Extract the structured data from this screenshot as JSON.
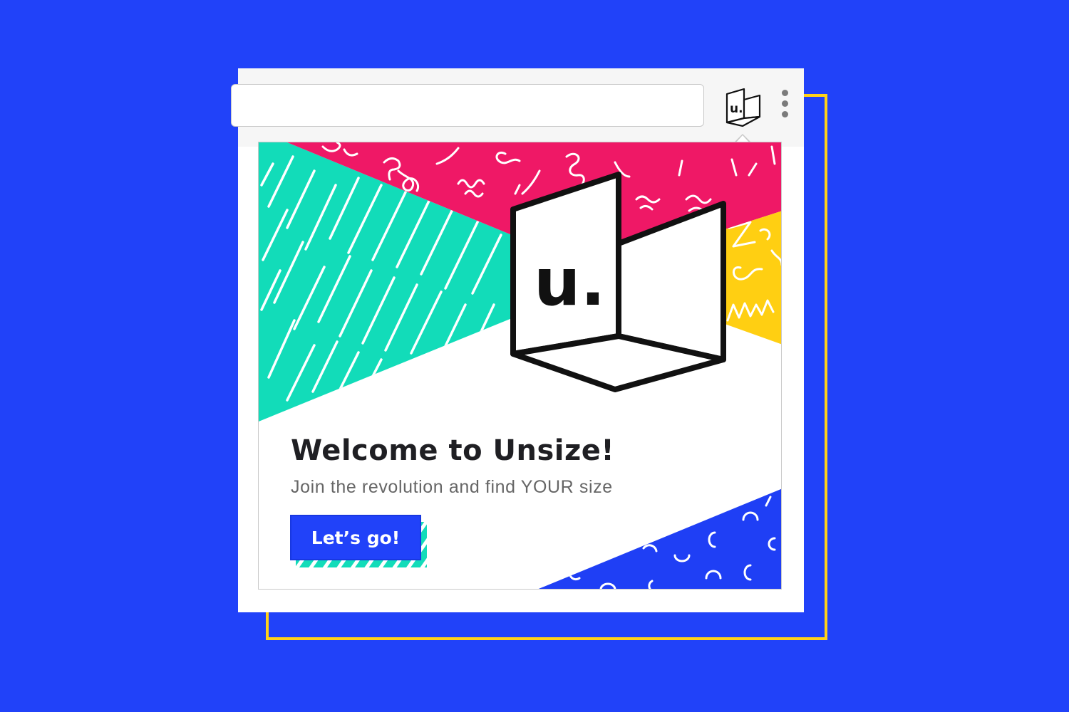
{
  "popup": {
    "title": "Welcome to Unsize!",
    "subtitle": "Join the revolution and find YOUR size",
    "cta_label": "Let’s go!"
  },
  "extension": {
    "logo_text": "u.",
    "icon": "unsize-box-logo-icon"
  },
  "browser": {
    "menu_icon": "more-vert-icon",
    "address_value": ""
  },
  "colors": {
    "page_background": "#2142f9",
    "frame_accent": "#ffd21a",
    "teal": "#12dcb9",
    "magenta": "#ef1866",
    "yellow": "#ffcf12",
    "blue": "#2142f9",
    "title_text": "#1f1f23",
    "subtitle_text": "#666666"
  }
}
